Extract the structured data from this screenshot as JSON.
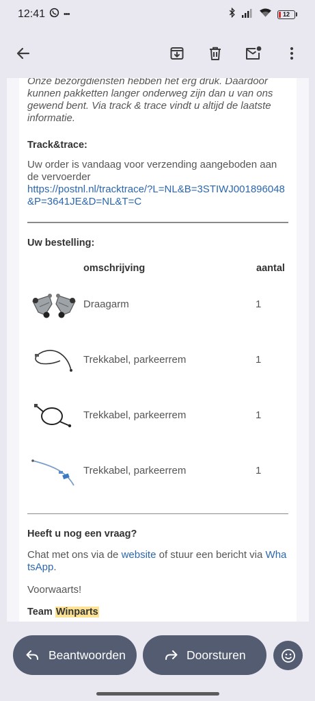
{
  "status_bar": {
    "time": "12:41",
    "more": "•••",
    "battery": "12",
    "icons": [
      "whatsapp-icon",
      "bluetooth-icon",
      "signal-icon",
      "wifi-icon",
      "battery-icon"
    ]
  },
  "toolbar": {
    "icons": [
      "back-arrow-icon",
      "archive-icon",
      "trash-icon",
      "mark-unread-icon",
      "more-vert-icon"
    ]
  },
  "email": {
    "intro": "Onze bezorgdiensten hebben het erg druk. Daardoor kunnen pakketten langer onderweg zijn dan u van ons gewend bent. Via track & trace vindt u altijd de laatste informatie.",
    "track_title": "Track&trace:",
    "track_text": "Uw order is vandaag voor verzending aangeboden aan de vervoerder",
    "track_link": "https://postnl.nl/tracktrace/?L=NL&B=3STIWJ001896048&P=3641JE&D=NL&T=C",
    "order_title": "Uw bestelling:",
    "columns": {
      "description": "omschrijving",
      "quantity": "aantal"
    },
    "items": [
      {
        "description": "Draagarm",
        "quantity": "1",
        "image": "control-arm-image"
      },
      {
        "description": "Trekkabel, parkeerrem",
        "quantity": "1",
        "image": "cable-image"
      },
      {
        "description": "Trekkabel, parkeerrem",
        "quantity": "1",
        "image": "cable-image"
      },
      {
        "description": "Trekkabel, parkeerrem",
        "quantity": "1",
        "image": "cable-image"
      }
    ],
    "question_title": "Heeft u nog een vraag?",
    "chat_pre": "Chat met ons via de ",
    "chat_link_website": "website",
    "chat_mid": " of stuur een bericht via ",
    "chat_link_whatsapp": "WhatsApp",
    "chat_post": ".",
    "closing": "Voorwaarts!",
    "signature_team": "Team",
    "signature_brand": "Winparts"
  },
  "actions": {
    "reply_label": "Beantwoorden",
    "forward_label": "Doorsturen"
  },
  "colors": {
    "background": "#e9e8f0",
    "link": "#2a67b0",
    "action_button": "#545c72",
    "highlight": "#fde293"
  }
}
